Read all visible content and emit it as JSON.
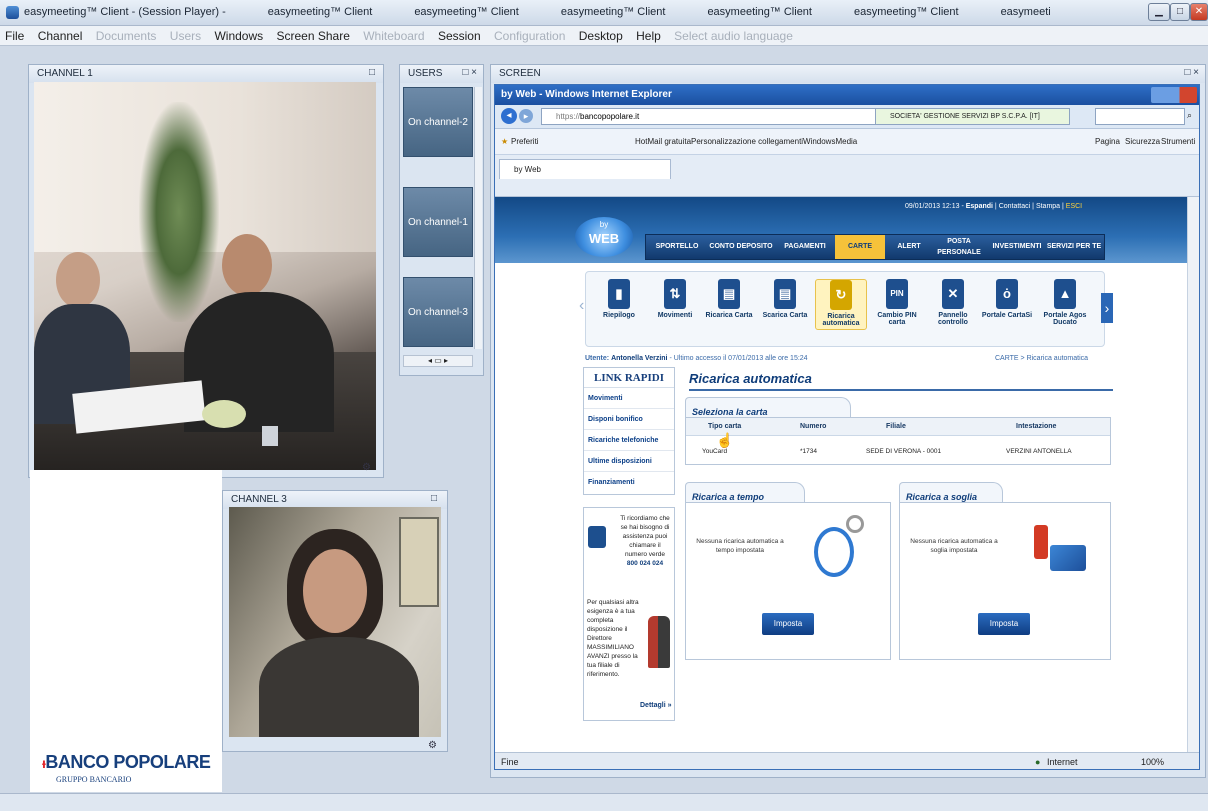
{
  "window": {
    "apps": [
      "easymeeting™ Client - (Session Player) -",
      "easymeeting™ Client",
      "easymeeting™ Client",
      "easymeeting™ Client",
      "easymeeting™ Client",
      "easymeeting™ Client",
      "easymeeti"
    ]
  },
  "menu": {
    "items": [
      {
        "label": "File",
        "enabled": true
      },
      {
        "label": "Channel",
        "enabled": true
      },
      {
        "label": "Documents",
        "enabled": false
      },
      {
        "label": "Users",
        "enabled": false
      },
      {
        "label": "Windows",
        "enabled": true
      },
      {
        "label": "Screen Share",
        "enabled": true
      },
      {
        "label": "Whiteboard",
        "enabled": false
      },
      {
        "label": "Session",
        "enabled": true
      },
      {
        "label": "Configuration",
        "enabled": false
      },
      {
        "label": "Desktop",
        "enabled": true
      },
      {
        "label": "Help",
        "enabled": true
      },
      {
        "label": "Select audio language",
        "enabled": false
      }
    ]
  },
  "panels": {
    "channel1": "CHANNEL 1",
    "users": "USERS",
    "screen": "SCREEN",
    "channel3": "CHANNEL 3"
  },
  "users": [
    "On channel-2",
    "On channel-1",
    "On channel-3"
  ],
  "logo": {
    "name": "BANCO POPOLARE",
    "sub": "GRUPPO BANCARIO"
  },
  "ie": {
    "title": "by Web - Windows Internet Explorer",
    "url": "https://",
    "domain": "bancopopolare.it",
    "cert": "SOCIETA' GESTIONE SERVIZI BP S.C.P.A. [IT]",
    "favorites": [
      "Preferiti",
      "HotMail gratuita",
      "Personalizzazione collegamenti",
      "WindowsMedia"
    ],
    "tab": "by Web",
    "tools": [
      "Pagina",
      "Sicurezza",
      "Strumenti"
    ],
    "status_left": "Fine",
    "status_zone": "Internet",
    "zoom": "100%"
  },
  "bank": {
    "topbar": {
      "datetime": "09/01/2013 12:13",
      "espandi": "Espandi",
      "contattaci": "Contattaci",
      "stampa": "Stampa",
      "esci": "ESCI"
    },
    "logo_by": "by",
    "logo_web": "WEB",
    "nav": [
      "SPORTELLO",
      "CONTO DEPOSITO",
      "PAGAMENTI",
      "CARTE",
      "ALERT",
      "POSTA PERSONALE",
      "INVESTIMENTI",
      "SERVIZI PER TE"
    ],
    "tools": [
      {
        "label": "Riepilogo",
        "glyph": "▮"
      },
      {
        "label": "Movimenti",
        "glyph": "⇅"
      },
      {
        "label": "Ricarica Carta",
        "glyph": "▤"
      },
      {
        "label": "Scarica Carta",
        "glyph": "▤"
      },
      {
        "label": "Ricarica automatica",
        "glyph": "↻"
      },
      {
        "label": "Cambio PIN carta",
        "glyph": "PIN"
      },
      {
        "label": "Pannello controllo",
        "glyph": "✕"
      },
      {
        "label": "Portale CartaSi",
        "glyph": "ȯ"
      },
      {
        "label": "Portale Agos Ducato",
        "glyph": "▲"
      }
    ],
    "user_line": {
      "label": "Utente:",
      "name": "Antonella Verzini",
      "last": "- Ultimo accesso il 07/01/2013 alle ore 15:24"
    },
    "crumb": "CARTE > Ricarica automatica",
    "links_title": "LINK RAPIDI",
    "links": [
      "Movimenti",
      "Disponi bonifico",
      "Ricariche telefoniche",
      "Ultime disposizioni",
      "Finanziamenti"
    ],
    "help": {
      "text": "Ti ricordiamo che se hai bisogno di assistenza puoi chiamare il numero verde",
      "phone": "800 024 024",
      "text2": "Per qualsiasi altra esigenza è a tua completa disposizione il Direttore MASSIMILIANO AVANZI presso la tua filiale di riferimento.",
      "more": "Dettagli »"
    },
    "heading": "Ricarica automatica",
    "select_card": "Seleziona la carta",
    "table": {
      "headers": [
        "Tipo carta",
        "Numero",
        "Filiale",
        "Intestazione"
      ],
      "row": [
        "YouCard",
        "*1734",
        "SEDE DI VERONA - 0001",
        "VERZINI ANTONELLA"
      ]
    },
    "tempo": {
      "title": "Ricarica a tempo",
      "text": "Nessuna ricarica automatica a tempo impostata",
      "button": "Imposta"
    },
    "soglia": {
      "title": "Ricarica a soglia",
      "text": "Nessuna ricarica automatica a soglia impostata",
      "button": "Imposta"
    }
  }
}
